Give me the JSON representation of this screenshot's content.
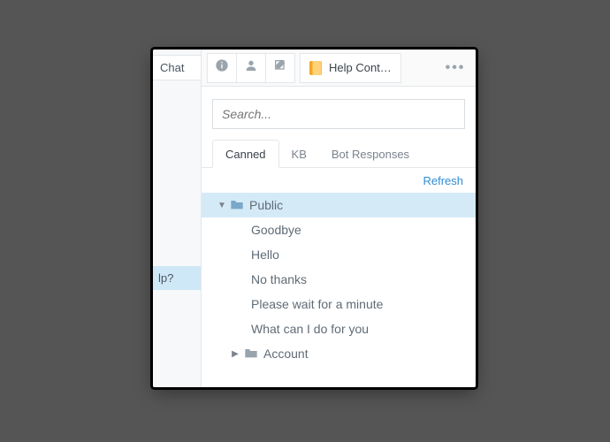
{
  "leftStrip": {
    "chat": "Chat",
    "help": "lp?"
  },
  "toolbar": {
    "title": "Help Cont…"
  },
  "search": {
    "placeholder": "Search..."
  },
  "tabs": {
    "t0": "Canned",
    "t1": "KB",
    "t2": "Bot Responses"
  },
  "actions": {
    "refresh": "Refresh"
  },
  "tree": {
    "public": "Public",
    "items": {
      "i0": "Goodbye",
      "i1": "Hello",
      "i2": "No thanks",
      "i3": "Please wait for a minute",
      "i4": "What can I do for you"
    },
    "account": "Account"
  }
}
